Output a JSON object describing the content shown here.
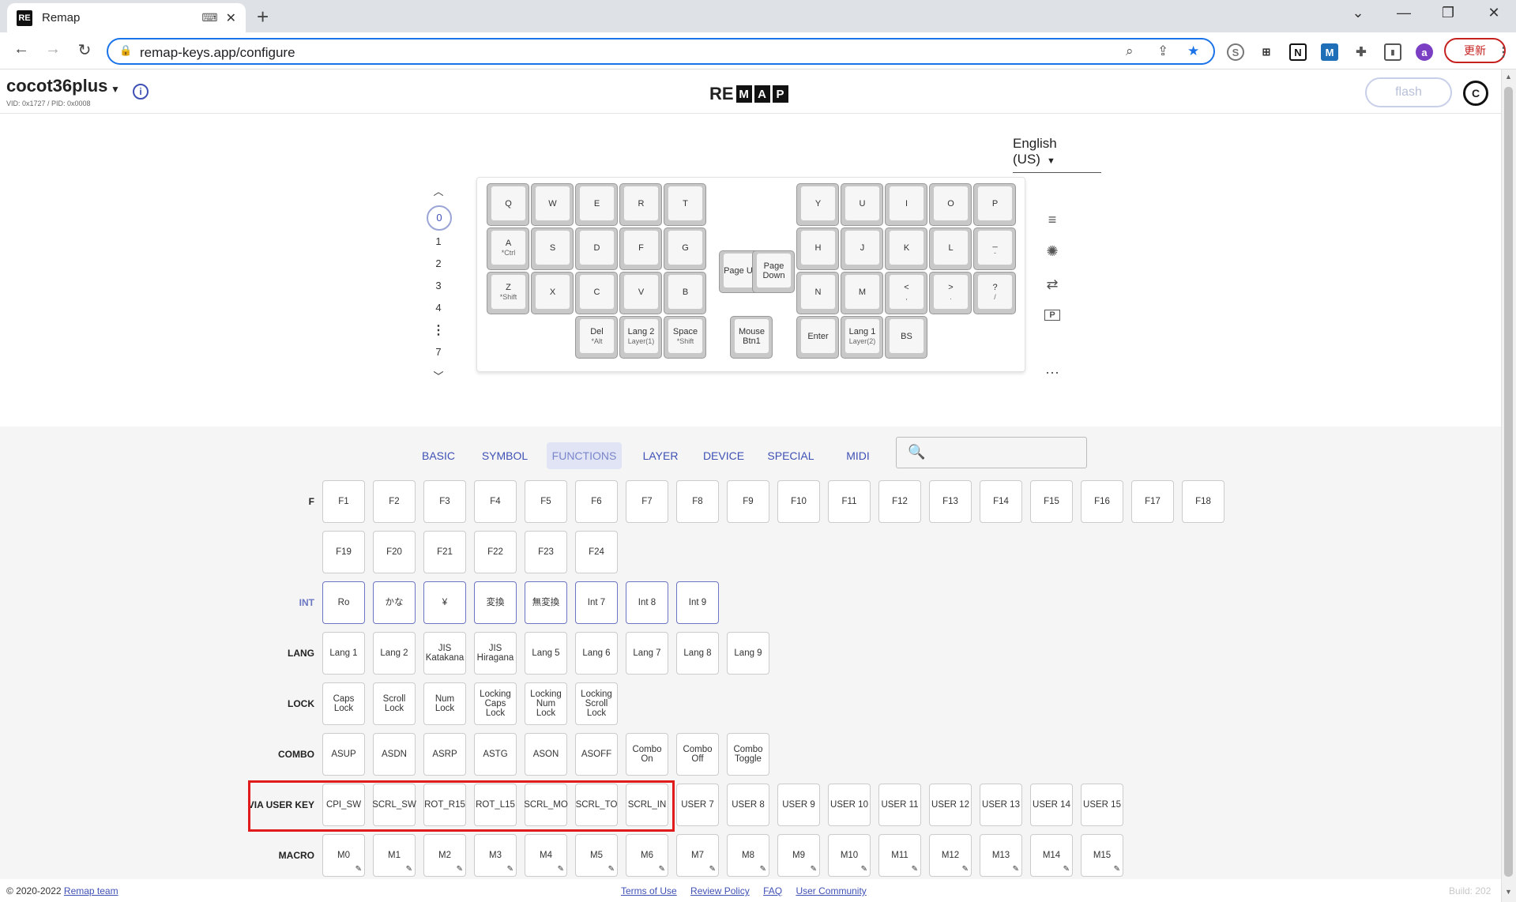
{
  "browser": {
    "tab_title": "Remap",
    "favicon": "RE",
    "url": "remap-keys.app/configure",
    "update_label": "更新",
    "profile_initial": "a"
  },
  "header": {
    "keyboard_name": "cocot36plus",
    "vid_pid": "VID: 0x1727 / PID: 0x0008",
    "logo_prefix": "RE",
    "logo_letters": [
      "M",
      "A",
      "P"
    ],
    "flash_label": "flash"
  },
  "language": "English (US)",
  "layers": [
    "0",
    "1",
    "2",
    "3",
    "4",
    "⋮",
    "7"
  ],
  "keyboard": {
    "rows": [
      [
        {
          "l": "Q"
        },
        {
          "l": "W"
        },
        {
          "l": "E"
        },
        {
          "l": "R"
        },
        {
          "l": "T"
        },
        {
          "l": "Y"
        },
        {
          "l": "U"
        },
        {
          "l": "I"
        },
        {
          "l": "O"
        },
        {
          "l": "P"
        }
      ],
      [
        {
          "l": "A",
          "s": "*Ctrl"
        },
        {
          "l": "S"
        },
        {
          "l": "D"
        },
        {
          "l": "F"
        },
        {
          "l": "G"
        },
        {
          "l": "Page Up"
        },
        {
          "l": "Page Down"
        },
        {
          "l": "H"
        },
        {
          "l": "J"
        },
        {
          "l": "K"
        },
        {
          "l": "L"
        },
        {
          "l": "_",
          "s": "-"
        }
      ],
      [
        {
          "l": "Z",
          "s": "*Shift"
        },
        {
          "l": "X"
        },
        {
          "l": "C"
        },
        {
          "l": "V"
        },
        {
          "l": "B"
        },
        {
          "l": "N"
        },
        {
          "l": "M"
        },
        {
          "l": "<",
          "s": ","
        },
        {
          "l": ">",
          "s": "."
        },
        {
          "l": "?",
          "s": "/"
        }
      ],
      [
        {
          "l": "Del",
          "s": "*Alt"
        },
        {
          "l": "Lang 2",
          "s": "Layer(1)"
        },
        {
          "l": "Space",
          "s": "*Shift"
        },
        {
          "l": "Mouse Btn1"
        },
        {
          "l": "Enter"
        },
        {
          "l": "Lang 1",
          "s": "Layer(2)"
        },
        {
          "l": "BS"
        }
      ]
    ]
  },
  "categories": [
    "BASIC",
    "SYMBOL",
    "FUNCTIONS",
    "LAYER",
    "DEVICE",
    "SPECIAL",
    "MIDI"
  ],
  "active_category": "FUNCTIONS",
  "keygroups": [
    {
      "label": "F",
      "keys": [
        "F1",
        "F2",
        "F3",
        "F4",
        "F5",
        "F6",
        "F7",
        "F8",
        "F9",
        "F10",
        "F11",
        "F12",
        "F13",
        "F14",
        "F15",
        "F16",
        "F17",
        "F18"
      ]
    },
    {
      "label": "",
      "keys": [
        "F19",
        "F20",
        "F21",
        "F22",
        "F23",
        "F24"
      ]
    },
    {
      "label": "INT",
      "keys": [
        "Ro",
        "かな",
        "¥",
        "変換",
        "無変換",
        "Int 7",
        "Int 8",
        "Int 9"
      ]
    },
    {
      "label": "LANG",
      "keys": [
        "Lang 1",
        "Lang 2",
        "JIS Katakana",
        "JIS Hiragana",
        "Lang 5",
        "Lang 6",
        "Lang 7",
        "Lang 8",
        "Lang 9"
      ]
    },
    {
      "label": "LOCK",
      "keys": [
        "Caps Lock",
        "Scroll Lock",
        "Num Lock",
        "Locking Caps Lock",
        "Locking Num Lock",
        "Locking Scroll Lock"
      ]
    },
    {
      "label": "COMBO",
      "keys": [
        "ASUP",
        "ASDN",
        "ASRP",
        "ASTG",
        "ASON",
        "ASOFF",
        "Combo On",
        "Combo Off",
        "Combo Toggle"
      ]
    },
    {
      "label": "VIA USER KEY",
      "keys": [
        "CPI_SW",
        "SCRL_SW",
        "ROT_R15",
        "ROT_L15",
        "SCRL_MO",
        "SCRL_TO",
        "SCRL_IN",
        "USER 7",
        "USER 8",
        "USER 9",
        "USER 10",
        "USER 11",
        "USER 12",
        "USER 13",
        "USER 14",
        "USER 15"
      ]
    },
    {
      "label": "MACRO",
      "keys": [
        "M0",
        "M1",
        "M2",
        "M3",
        "M4",
        "M5",
        "M6",
        "M7",
        "M8",
        "M9",
        "M10",
        "M11",
        "M12",
        "M13",
        "M14",
        "M15"
      ]
    }
  ],
  "footer": {
    "copyright": "© 2020-2022",
    "team_link": "Remap team",
    "links": [
      "Terms of Use",
      "Review Policy",
      "FAQ",
      "User Community"
    ],
    "build": "Build: 202"
  },
  "colors": {
    "accent": "#3f51b5",
    "highlight": "#e01b1b"
  }
}
